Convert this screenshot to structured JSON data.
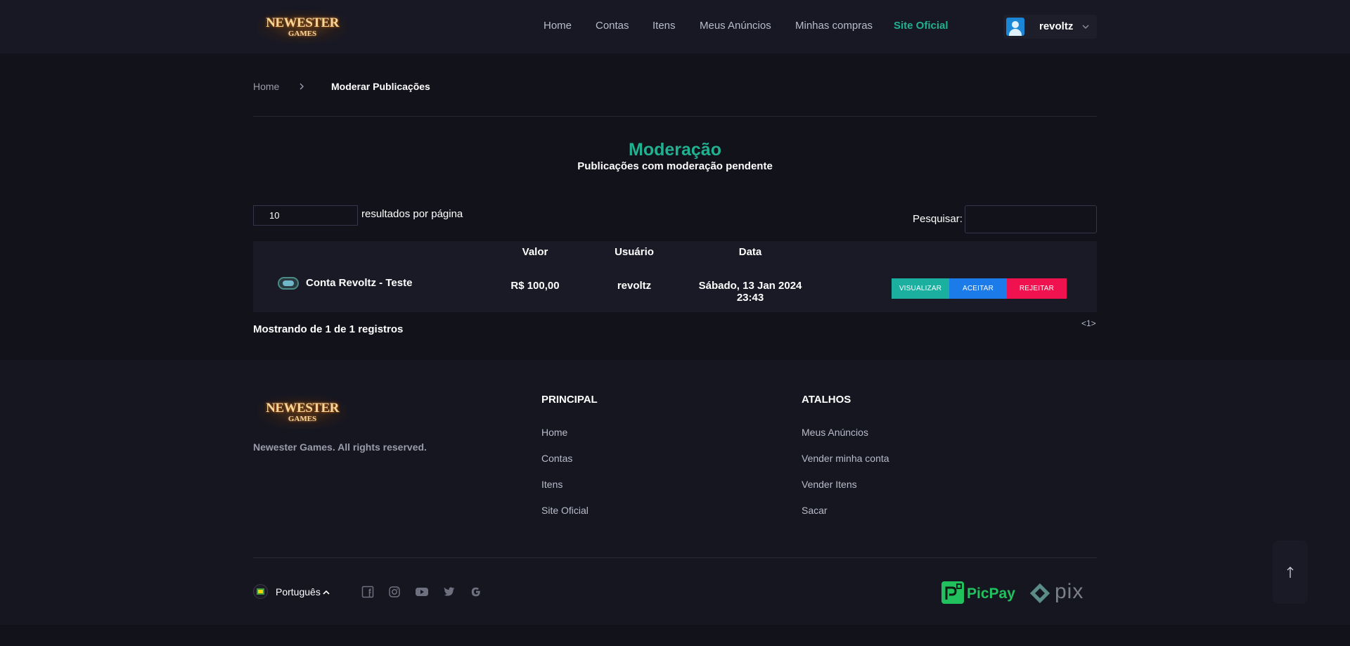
{
  "header": {
    "logo": {
      "line1": "NEWESTER",
      "line2": "GAMES"
    },
    "nav": [
      {
        "label": "Home"
      },
      {
        "label": "Contas"
      },
      {
        "label": "Itens"
      },
      {
        "label": "Meus Anúncios"
      },
      {
        "label": "Minhas compras"
      },
      {
        "label": "Site Oficial",
        "active": true
      }
    ],
    "user": {
      "name": "revoltz",
      "avatar_icon": "user-avatar-icon"
    }
  },
  "breadcrumb": {
    "home": "Home",
    "current": "Moderar Publicações",
    "separator_icon": "chevron-right-icon"
  },
  "page": {
    "title": "Moderação",
    "subtitle": "Publicações com moderação pendente",
    "accent_color": "#20b191"
  },
  "table_controls": {
    "page_length": "10",
    "page_length_label": "resultados por página",
    "search_label": "Pesquisar:",
    "search_value": ""
  },
  "table": {
    "columns": [
      "Valor",
      "Usuário",
      "Data"
    ],
    "rows": [
      {
        "name": "Conta Revoltz - Teste",
        "valor": "R$ 100,00",
        "usuario": "revoltz",
        "data": "Sábado, 13 Jan 2024 23:43",
        "actions": {
          "view": "VISUALIZAR",
          "accept": "ACEITAR",
          "reject": "REJEITAR"
        }
      }
    ],
    "info": "Mostrando de 1 de 1 registros",
    "pager": "<1>"
  },
  "footer": {
    "rights": "Newester Games. All rights reserved.",
    "principal": {
      "title": "PRINCIPAL",
      "links": [
        "Home",
        "Contas",
        "Itens",
        "Site Oficial"
      ]
    },
    "atalhos": {
      "title": "ATALHOS",
      "links": [
        "Meus Anúncios",
        "Vender minha conta",
        "Vender Itens",
        "Sacar"
      ]
    },
    "language": "Português",
    "social_icons": [
      "facebook-icon",
      "instagram-icon",
      "youtube-icon",
      "twitter-icon",
      "google-icon"
    ],
    "payments": {
      "picpay": "PicPay",
      "pix": "pix"
    }
  },
  "colors": {
    "bg": "#12121b",
    "header": "#181824",
    "view_btn": "#1bafa0",
    "accept_btn": "#1b7be8",
    "reject_btn": "#f0124e"
  }
}
